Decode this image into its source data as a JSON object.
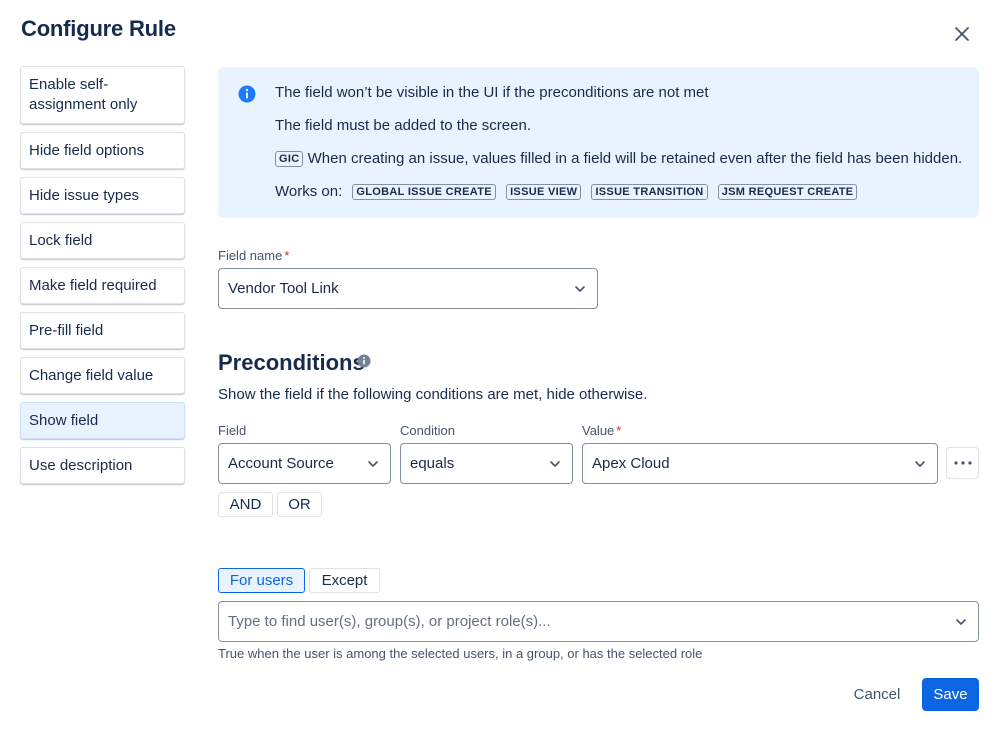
{
  "dialog": {
    "title": "Configure Rule"
  },
  "sidebar": {
    "items": [
      {
        "label": "Enable self-assignment only"
      },
      {
        "label": "Hide field options"
      },
      {
        "label": "Hide issue types"
      },
      {
        "label": "Lock field"
      },
      {
        "label": "Make field required"
      },
      {
        "label": "Pre-fill field"
      },
      {
        "label": "Change field value"
      },
      {
        "label": "Show field",
        "active": true
      },
      {
        "label": "Use description"
      }
    ]
  },
  "info": {
    "line1": "The field won’t be visible in the UI if the preconditions are not met",
    "line2": "The field must be added to the screen.",
    "gic_badge": "GIC",
    "line3": "When creating an issue, values filled in a field will be retained even after the field has been hidden.",
    "works_on_label": "Works on:",
    "works_on": [
      "GLOBAL ISSUE CREATE",
      "ISSUE VIEW",
      "ISSUE TRANSITION",
      "JSM REQUEST CREATE"
    ]
  },
  "field_name": {
    "label": "Field name",
    "required_mark": "*",
    "value": "Vendor Tool Link"
  },
  "preconditions": {
    "title": "Preconditions",
    "description": "Show the field if the following conditions are met, hide otherwise.",
    "field_label": "Field",
    "condition_label": "Condition",
    "value_label": "Value",
    "required_mark": "*",
    "field_value": "Account Source",
    "condition_value": "equals",
    "value_value": "Apex Cloud",
    "and_label": "AND",
    "or_label": "OR"
  },
  "users": {
    "for_users_label": "For users",
    "except_label": "Except",
    "placeholder": "Type to find user(s), group(s), or project role(s)...",
    "helper": "True when the user is among the selected users, in a group, or has the selected role"
  },
  "footer": {
    "cancel_label": "Cancel",
    "save_label": "Save"
  },
  "colors": {
    "primary": "#0c66e4",
    "info_bg": "#e9f2ff",
    "required": "#c9372c",
    "info_icon": "#1d7afc"
  }
}
